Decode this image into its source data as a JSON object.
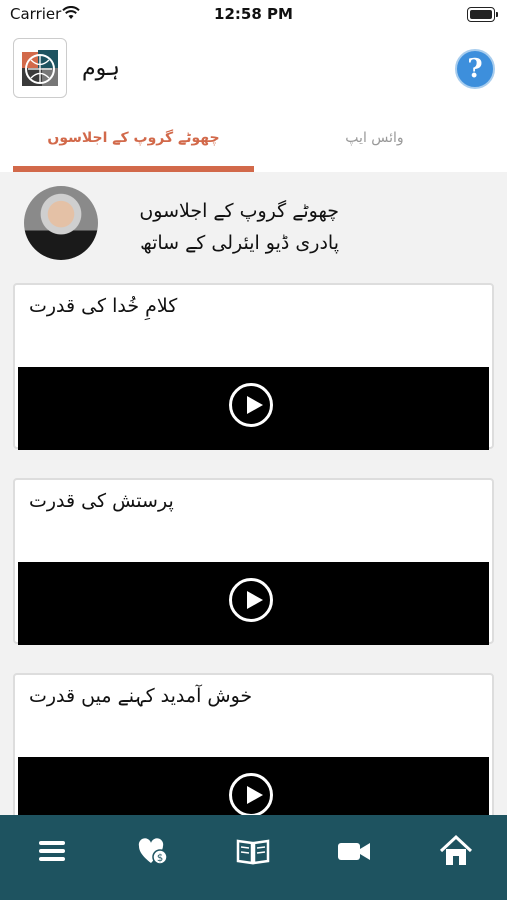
{
  "status_bar": {
    "carrier": "Carrier",
    "time": "12:58 PM"
  },
  "header": {
    "title": "ہوم"
  },
  "tabs": [
    {
      "label": "چھوٹے گروپ کے اجلاسوں",
      "active": true
    },
    {
      "label": "وائس ایپ",
      "active": false
    }
  ],
  "intro": {
    "title": "چھوٹے گروپ کے اجلاسوں",
    "subtitle": "پادری ڈیو ایئرلی کے ساتھ"
  },
  "cards": [
    {
      "title": "کلامِ خُدا کی قدرت"
    },
    {
      "title": "پرستش کی قدرت"
    },
    {
      "title": "خوش آمدید کہنے میں قدرت"
    }
  ],
  "tabbar": {
    "icons": [
      "menu-icon",
      "heart-donate-icon",
      "bible-icon",
      "video-camera-icon",
      "home-icon"
    ]
  },
  "colors": {
    "accent": "#d2694a",
    "tabbar": "#1e5360",
    "help": "#3d8fdc"
  }
}
